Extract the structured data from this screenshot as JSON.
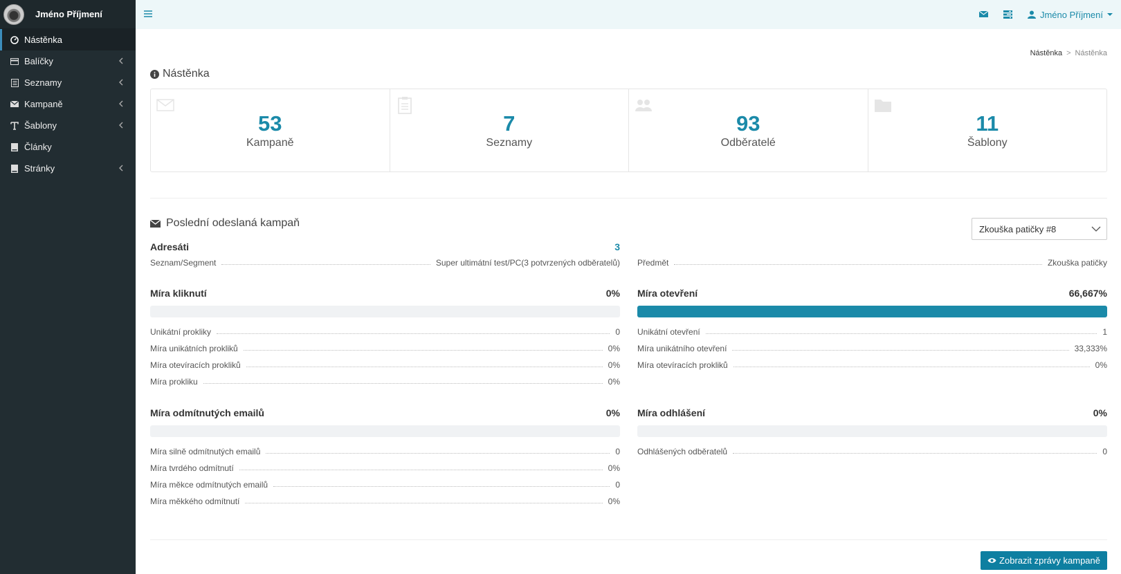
{
  "sidebar": {
    "user_name": "Jméno Příjmení",
    "items": [
      {
        "label": "Nástěnka",
        "icon": "dashboard-icon",
        "active": true
      },
      {
        "label": "Balíčky",
        "icon": "package-icon"
      },
      {
        "label": "Seznamy",
        "icon": "list-icon"
      },
      {
        "label": "Kampaně",
        "icon": "envelope-icon"
      },
      {
        "label": "Šablony",
        "icon": "text-icon"
      },
      {
        "label": "Články",
        "icon": "book-icon"
      },
      {
        "label": "Stránky",
        "icon": "book-icon"
      }
    ]
  },
  "topbar": {
    "user_label": "Jméno Příjmení"
  },
  "breadcrumb": {
    "home": "Nástěnka",
    "current": "Nástěnka"
  },
  "page_title": "Nástěnka",
  "stats": [
    {
      "value": "53",
      "label": "Kampaně",
      "icon": "envelope-icon"
    },
    {
      "value": "7",
      "label": "Seznamy",
      "icon": "clipboard-icon"
    },
    {
      "value": "93",
      "label": "Odběratelé",
      "icon": "users-icon"
    },
    {
      "value": "11",
      "label": "Šablony",
      "icon": "folder-icon"
    }
  ],
  "campaign": {
    "title": "Poslední odeslaná kampaň",
    "selected": "Zkouška patičky #8",
    "recipients_label": "Adresáti",
    "recipients_value": "3",
    "list_label": "Seznam/Segment",
    "list_value": "Super ultimátní test/PC(3 potvrzených odběratelů)",
    "subject_label": "Předmět",
    "subject_value": "Zkouška patičky",
    "click_rate": {
      "label": "Míra kliknutí",
      "value": "0%",
      "fill": 0,
      "rows": [
        {
          "k": "Unikátní prokliky",
          "v": "0"
        },
        {
          "k": "Míra unikátních prokliků",
          "v": "0%"
        },
        {
          "k": "Míra otevíracích prokliků",
          "v": "0%"
        },
        {
          "k": "Míra prokliku",
          "v": "0%"
        }
      ]
    },
    "open_rate": {
      "label": "Míra otevření",
      "value": "66,667%",
      "fill": 100,
      "rows": [
        {
          "k": "Unikátní otevření",
          "v": "1"
        },
        {
          "k": "Míra unikátního otevření",
          "v": "33,333%"
        },
        {
          "k": "Míra otevíracích prokliků",
          "v": "0%"
        }
      ]
    },
    "bounce_rate": {
      "label": "Míra odmítnutých emailů",
      "value": "0%",
      "fill": 0,
      "rows": [
        {
          "k": "Míra silně odmítnutých emailů",
          "v": "0"
        },
        {
          "k": "Míra tvrdého odmítnutí",
          "v": "0%"
        },
        {
          "k": "Míra měkce odmítnutých emailů",
          "v": "0"
        },
        {
          "k": "Míra měkkého odmítnutí",
          "v": "0%"
        }
      ]
    },
    "unsub_rate": {
      "label": "Míra odhlášení",
      "value": "0%",
      "fill": 0,
      "rows": [
        {
          "k": "Odhlášených odběratelů",
          "v": "0"
        }
      ]
    },
    "button_label": "Zobrazit zprávy kampaně"
  },
  "colors": {
    "accent": "#1b8aa9",
    "sidebar_bg": "#222d32",
    "topbar_bg": "#edf7f9",
    "button_bg": "#0e7fa1"
  }
}
